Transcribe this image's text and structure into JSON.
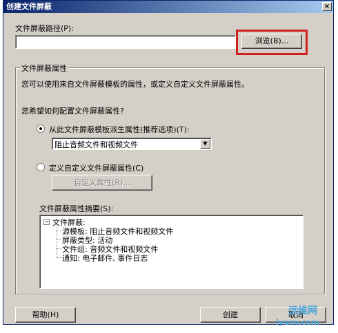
{
  "window": {
    "title": "创建文件屏蔽",
    "close_glyph": "×"
  },
  "path": {
    "label": "文件屏蔽路径(P):",
    "value": "",
    "browse_label": "浏览(B)..."
  },
  "group": {
    "legend": "文件屏蔽属性",
    "desc": "您可以使用来自文件屏蔽模板的属性，或定义自定义文件屏蔽属性。",
    "question": "您希望如何配置文件屏蔽属性?",
    "option_template": "从此文件屏蔽模板派生属性(推荐选项)(T):",
    "template_selected": "阻止音频文件和视频文件",
    "option_custom": "定义自定义文件屏蔽属性(C)",
    "custom_button": "自定义属性(R)...",
    "summary_label": "文件屏蔽属性摘要(S):",
    "tree": {
      "root": "文件屏蔽:",
      "expander": "−",
      "children": [
        "源模板: 阻止音频文件和视频文件",
        "屏蔽类型: 活动",
        "文件组: 音频文件和视频文件",
        "通知: 电子邮件, 事件日志"
      ]
    }
  },
  "buttons": {
    "help": "帮助(H)",
    "create": "创建",
    "cancel": "取消"
  },
  "watermark": {
    "line1": "运维网",
    "line2": "iyunv.com"
  },
  "colors": {
    "highlight_box": "#d21f1f",
    "titlebar": "#0a246a"
  }
}
